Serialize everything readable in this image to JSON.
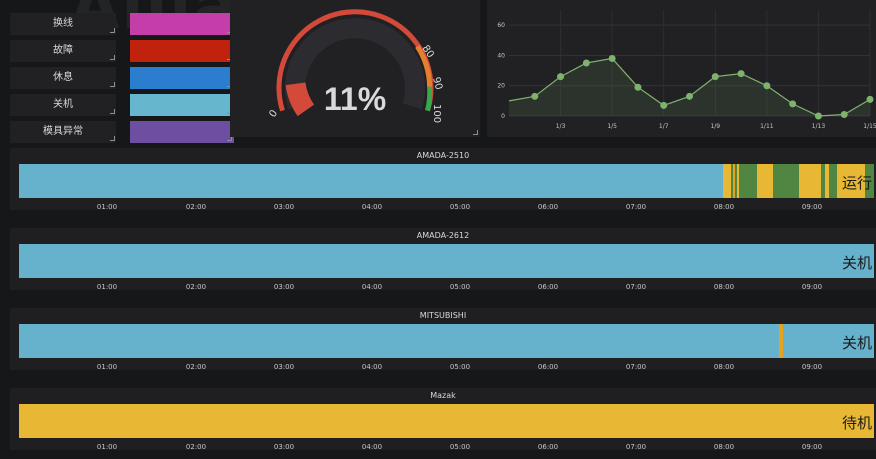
{
  "legend": [
    {
      "label": "换线",
      "color": "#c33ea9"
    },
    {
      "label": "故障",
      "color": "#c1220d"
    },
    {
      "label": "休息",
      "color": "#2b7dd0"
    },
    {
      "label": "关机",
      "color": "#66b7cd"
    },
    {
      "label": "模具异常",
      "color": "#6d4ea0"
    }
  ],
  "gauge": {
    "value_text": "11%",
    "value": 11,
    "ticks": [
      "0",
      "80",
      "90",
      "100"
    ],
    "colors": {
      "red": "#d44a3a",
      "orange": "#e2802e",
      "green": "#38a84a"
    }
  },
  "trend": {
    "y_ticks": [
      "0",
      "20",
      "40",
      "60"
    ],
    "x_ticks": [
      "1/3",
      "1/5",
      "1/7",
      "1/9",
      "1/11",
      "1/13",
      "1/15"
    ],
    "points": [
      10,
      13,
      26,
      35,
      38,
      19,
      7,
      13,
      26,
      28,
      20,
      8,
      0,
      1,
      11
    ],
    "line_color": "#7eb26d"
  },
  "time_ticks": [
    "01:00",
    "02:00",
    "03:00",
    "04:00",
    "05:00",
    "06:00",
    "07:00",
    "08:00",
    "09:00"
  ],
  "colors": {
    "shutdown": "#66b2cc",
    "running_green": "#508642",
    "standby_yellow": "#e8b834",
    "accent_orange": "#e5a21f"
  },
  "timelines": [
    {
      "name": "AMADA-2510",
      "state": "运行"
    },
    {
      "name": "AMADA-2612",
      "state": "关机"
    },
    {
      "name": "MITSUBISHI",
      "state": "关机"
    },
    {
      "name": "Mazak",
      "state": "待机"
    }
  ],
  "watermark": "Alliance of Industrial Internet"
}
